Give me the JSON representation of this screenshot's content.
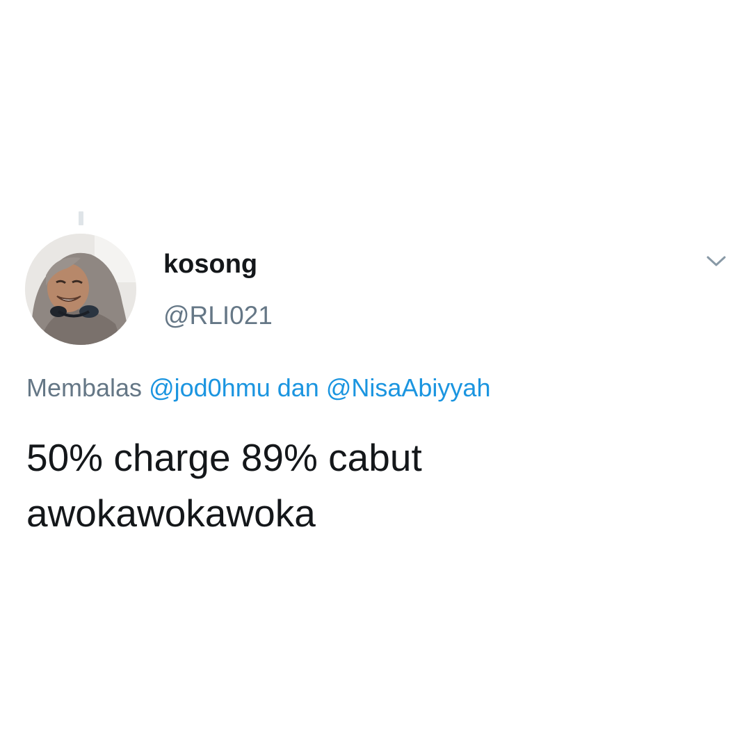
{
  "tweet": {
    "display_name": "kosong",
    "handle": "@RLI021",
    "avatar_icon": "profile-photo",
    "more_icon": "chevron-down-icon",
    "reply": {
      "prefix": "Membalas",
      "mention_1": "@jod0hmu",
      "conjunction": "dan",
      "mention_2": "@NisaAbiyyah"
    },
    "text": "50% charge 89% cabut\nawokawokawoka"
  },
  "colors": {
    "text_primary": "#14171a",
    "text_secondary": "#657786",
    "link": "#1b95e0",
    "background": "#ffffff"
  }
}
